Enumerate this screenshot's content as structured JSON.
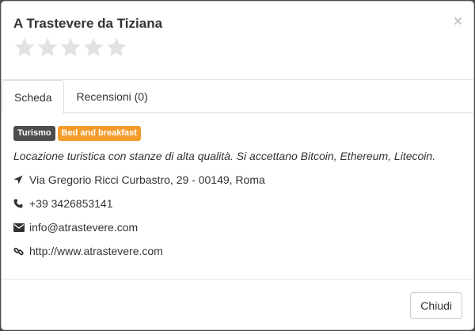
{
  "backdrop": {
    "text": "... ......"
  },
  "modal": {
    "title": "A Trastevere da Tiziana",
    "close_symbol": "×",
    "rating": {
      "value": 0,
      "max": 5,
      "star_color": "#e2e2e2"
    }
  },
  "tabs": [
    {
      "label": "Scheda",
      "active": true
    },
    {
      "label": "Recensioni (0)",
      "active": false
    }
  ],
  "details": {
    "badges": [
      {
        "label": "Turismo",
        "color": "#4d4d4d"
      },
      {
        "label": "Bed and breakfast",
        "color": "#f39c2c"
      }
    ],
    "description": "Locazione turistica con stanze di alta qualità. Si accettano Bitcoin, Ethereum, Litecoin.",
    "address": {
      "icon": "location-arrow-icon",
      "text": "Via Gregorio Ricci Curbastro, 29 - 00149, Roma"
    },
    "phone": {
      "icon": "phone-icon",
      "text": "+39 3426853141"
    },
    "email": {
      "icon": "envelope-icon",
      "text": "info@atrastevere.com"
    },
    "website": {
      "icon": "link-icon",
      "text": "http://www.atrastevere.com"
    }
  },
  "footer": {
    "close_label": "Chiudi"
  }
}
